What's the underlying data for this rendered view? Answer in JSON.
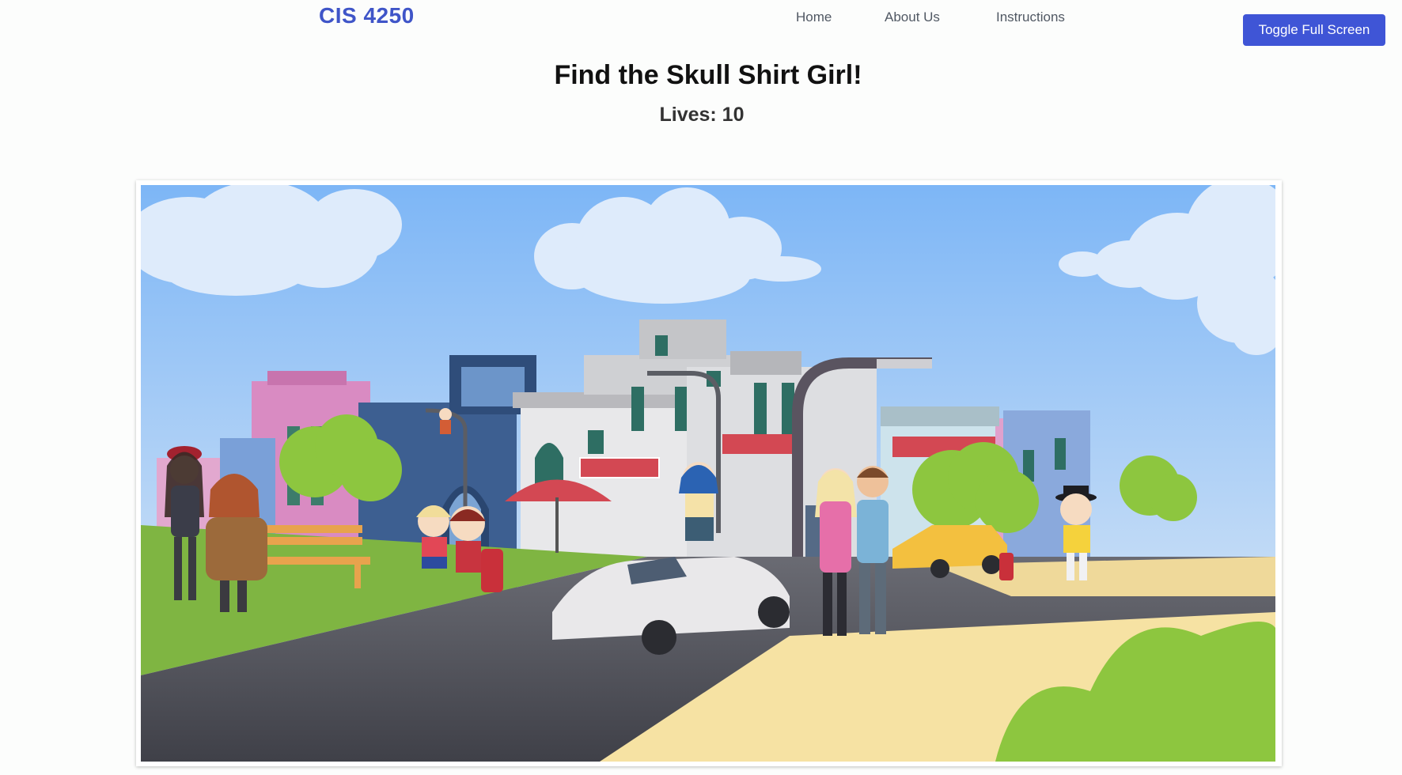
{
  "header": {
    "brand": "CIS 4250",
    "nav": [
      "Home",
      "About Us",
      "Instructions"
    ],
    "fullscreen_label": "Toggle Full Screen"
  },
  "game": {
    "title": "Find the Skull Shirt Girl!",
    "lives_text": "Lives: 10",
    "lives": 10
  },
  "colors": {
    "accent": "#3f55d6",
    "brand": "#3f55c8",
    "sky_top": "#7db6f6",
    "sky_bottom": "#e4effb",
    "grass": "#7fb542",
    "road": "#4e5058",
    "sidewalk": "#f6e2a3"
  }
}
